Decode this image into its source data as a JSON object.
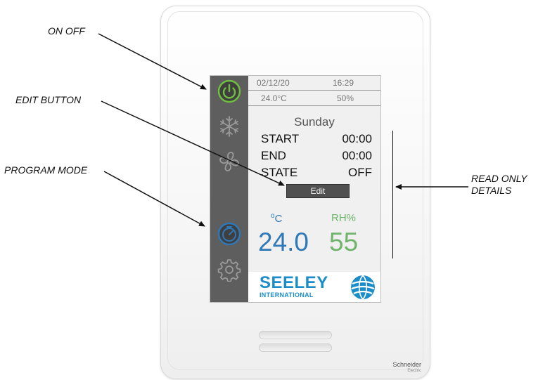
{
  "callouts": {
    "on_off": "ON OFF",
    "edit_button": "EDIT BUTTON",
    "program_mode": "PROGRAM MODE",
    "read_only_line1": "READ ONLY",
    "read_only_line2": "DETAILS"
  },
  "screen": {
    "header": {
      "date": "02/12/20",
      "time": "16:29",
      "temperature": "24.0°C",
      "humidity": "50%"
    },
    "sidebar": {
      "icons": [
        "power-icon",
        "snowflake-icon",
        "fan-icon",
        "program-timer-icon",
        "settings-gear-icon"
      ]
    },
    "program": {
      "day": "Sunday",
      "rows": [
        {
          "label": "START",
          "value": "00:00"
        },
        {
          "label": "END",
          "value": "00:00"
        },
        {
          "label": "STATE",
          "value": "OFF"
        }
      ],
      "edit_label": "Edit"
    },
    "readings": {
      "temp_unit_deg": "o",
      "temp_unit": "C",
      "humidity_unit": "RH%",
      "temperature": "24.0",
      "humidity": "55"
    },
    "logo": {
      "main": "SEELEY",
      "sub": "INTERNATIONAL"
    }
  },
  "device": {
    "brand": "Schneider",
    "brand_sub": "Electric"
  },
  "colors": {
    "power_green": "#6fbe3f",
    "temp_blue": "#2f78b8",
    "humidity_green": "#6fb46a",
    "logo_blue": "#1b8ec9",
    "sidebar_gray": "#5e5e5e"
  }
}
